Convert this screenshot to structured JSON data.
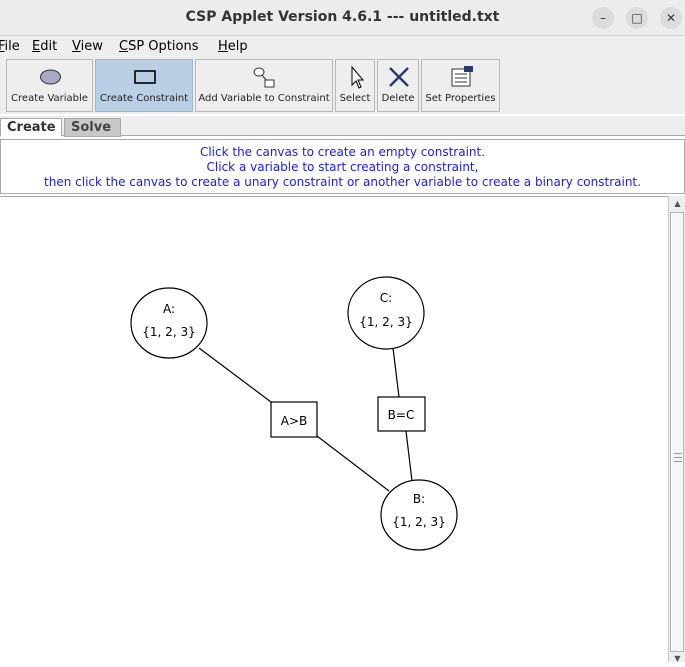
{
  "window": {
    "title": "CSP Applet Version 4.6.1 --- untitled.txt",
    "minimize": "–",
    "maximize": "□",
    "close": "✕"
  },
  "menu": [
    "File",
    "Edit",
    "View",
    "CSP Options",
    "Help"
  ],
  "toolbar": {
    "create_variable": "Create Variable",
    "create_constraint": "Create Constraint",
    "add_variable": "Add Variable to Constraint",
    "select": "Select",
    "delete": "Delete",
    "set_properties": "Set Properties",
    "active": "Create Constraint"
  },
  "tabs": {
    "create": "Create",
    "solve": "Solve",
    "active": "Create"
  },
  "instructions": {
    "line1": "Click the canvas to create an empty constraint.",
    "line2": "Click a variable to start creating a constraint,",
    "line3": "then click the canvas to create a unary constraint or another variable to create a binary constraint."
  },
  "graph": {
    "variables": [
      {
        "name": "A:",
        "domain": "{1, 2, 3}"
      },
      {
        "name": "C:",
        "domain": "{1, 2, 3}"
      },
      {
        "name": "B:",
        "domain": "{1, 2, 3}"
      }
    ],
    "constraints": [
      {
        "label": "A>B"
      },
      {
        "label": "B=C"
      }
    ]
  },
  "colors": {
    "instruction_text": "#1a1aff",
    "active_button": "#b9cfe6"
  }
}
